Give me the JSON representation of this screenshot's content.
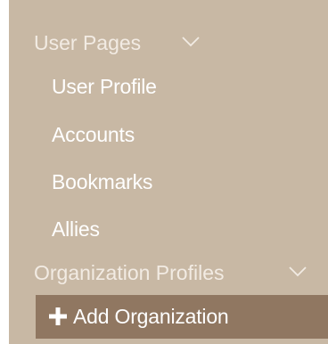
{
  "sidebar": {
    "sections": [
      {
        "label": "User Pages",
        "icon": "chevron-down-icon",
        "items": [
          {
            "label": "User Profile"
          },
          {
            "label": "Accounts"
          },
          {
            "label": "Bookmarks"
          },
          {
            "label": "Allies"
          }
        ]
      },
      {
        "label": "Organization Profiles",
        "icon": "chevron-down-icon",
        "items": [
          {
            "label": "Add Organization",
            "icon": "plus-icon"
          }
        ]
      }
    ]
  },
  "colors": {
    "sidebar_bg": "#c8b8a4",
    "header_text": "#f2ebe3",
    "item_text": "#ffffff",
    "active_bg": "#907761"
  }
}
